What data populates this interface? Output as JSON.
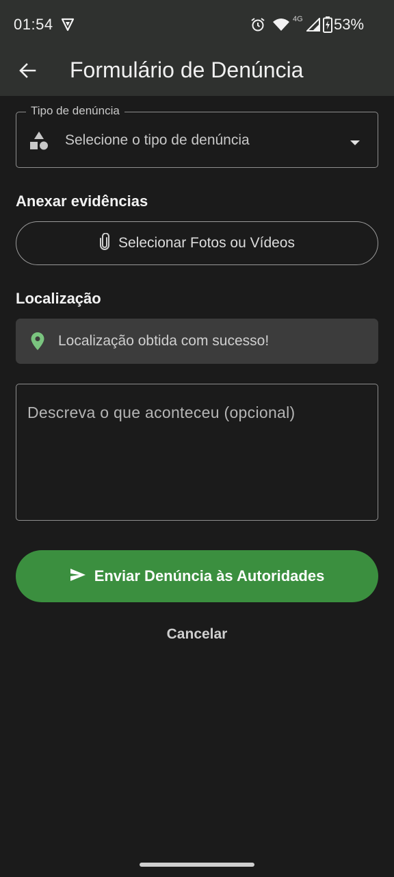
{
  "status_bar": {
    "time": "01:54",
    "network_type": "4G",
    "battery_percent": "53%",
    "icons": [
      "vpn-shield-icon",
      "alarm-icon",
      "wifi-icon",
      "cell-signal-icon",
      "battery-charging-icon"
    ]
  },
  "app_bar": {
    "title": "Formulário de Denúncia",
    "back_icon": "arrow-back-icon"
  },
  "form": {
    "type_field": {
      "label": "Tipo de denúncia",
      "placeholder": "Selecione o tipo de denúncia",
      "icon": "category-icon"
    },
    "evidence": {
      "section_title": "Anexar evidências",
      "button_label": "Selecionar Fotos ou Vídeos",
      "icon": "paperclip-icon"
    },
    "location": {
      "section_title": "Localização",
      "status_text": "Localização obtida com sucesso!",
      "icon": "location-pin-icon",
      "pin_color": "#7ac47f"
    },
    "description": {
      "placeholder": "Descreva o que aconteceu (opcional)"
    },
    "submit": {
      "label": "Enviar Denúncia às Autoridades",
      "icon": "send-icon",
      "color": "#3b8f3f"
    },
    "cancel": {
      "label": "Cancelar"
    }
  },
  "theme": {
    "background": "#1b1b1b",
    "app_bar": "#2f312f",
    "accent_green": "#3b8f3f"
  }
}
